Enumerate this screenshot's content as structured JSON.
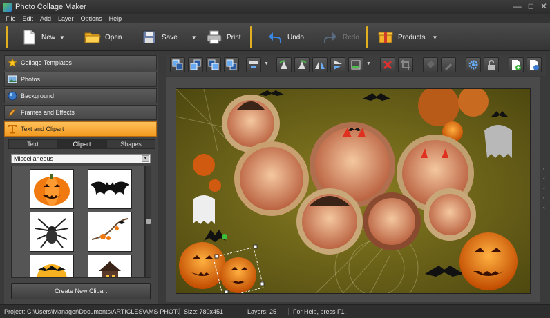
{
  "app": {
    "title": "Photo Collage Maker"
  },
  "menu": [
    "File",
    "Edit",
    "Add",
    "Layer",
    "Options",
    "Help"
  ],
  "toolbar": {
    "new_label": "New",
    "open_label": "Open",
    "save_label": "Save",
    "print_label": "Print",
    "undo_label": "Undo",
    "redo_label": "Redo",
    "products_label": "Products"
  },
  "sidebar": {
    "items": [
      {
        "label": "Collage Templates",
        "icon": "star-icon"
      },
      {
        "label": "Photos",
        "icon": "photos-icon"
      },
      {
        "label": "Background",
        "icon": "background-icon"
      },
      {
        "label": "Frames and Effects",
        "icon": "frames-icon"
      },
      {
        "label": "Text and Clipart",
        "icon": "text-clipart-icon",
        "active": true
      }
    ],
    "tabs": [
      "Text",
      "Clipart",
      "Shapes"
    ],
    "selected_tab": "Clipart",
    "category_select": "Miscellaneous",
    "clipart": [
      "pumpkin-clip",
      "bat-clip",
      "spider-clip",
      "branch-clip",
      "moon-bat-clip",
      "house-clip"
    ],
    "create_button_label": "Create New Clipart"
  },
  "status": {
    "project": "Project: C:\\Users\\Manager\\Documents\\ARTICLES\\AMS-PHOTO-S...",
    "size": "Size: 780x451",
    "layers": "Layers: 25",
    "help": "For Help, press F1."
  },
  "colors": {
    "accent": "#f29a20",
    "separator": "#e0b020",
    "background": "#6b6418"
  }
}
